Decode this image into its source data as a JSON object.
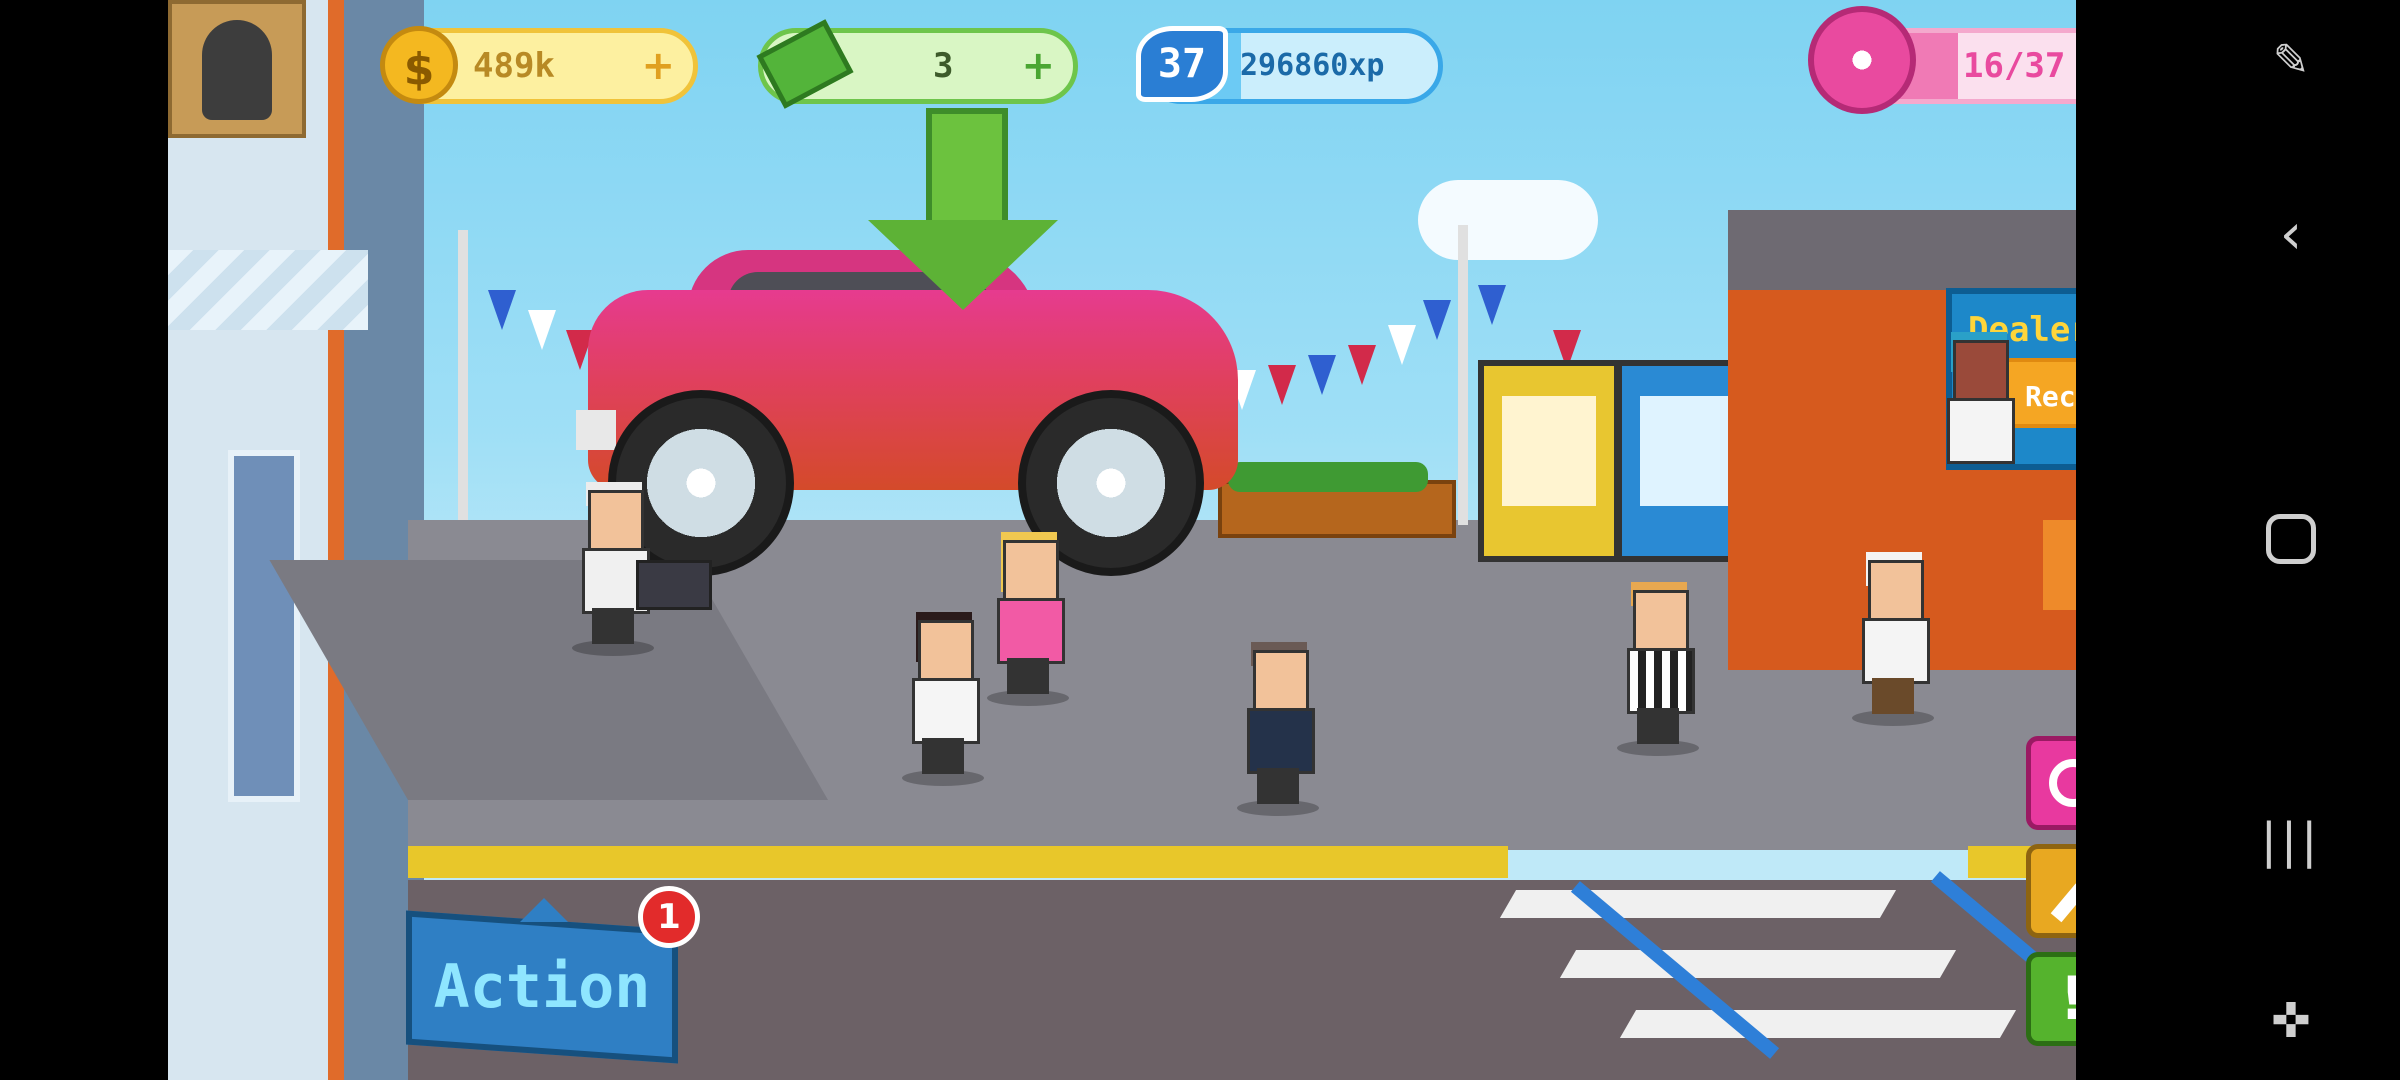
{
  "hud": {
    "coins": "489k",
    "coins_plus": "+",
    "cash": "3",
    "cash_plus": "+",
    "level": "37",
    "xp": "296860xp",
    "xp_progress": 0.32,
    "customers": "16/37",
    "customers_progress": 0.43,
    "coin_symbol": "$"
  },
  "scene": {
    "dealer_sign": "Dealer S",
    "recruit_label": "Recruit"
  },
  "controls": {
    "action_label": "Action",
    "action_badge": "1"
  },
  "side_buttons": [
    {
      "icon": "donut-ring-icon",
      "color": "#e8399f"
    },
    {
      "icon": "wrench-icon",
      "color": "#e8a821"
    },
    {
      "icon": "exclamation-icon",
      "color": "#55b32d",
      "glyph": "!"
    }
  ],
  "system_bar": {
    "icons": [
      "screenshot-icon",
      "back-icon",
      "home-icon",
      "recents-icon",
      "game-launcher-icon"
    ]
  },
  "colors": {
    "sky": "#8fd8f4",
    "car": "#e2457a",
    "accent_green": "#5db236",
    "accent_pink": "#e94a9f"
  }
}
